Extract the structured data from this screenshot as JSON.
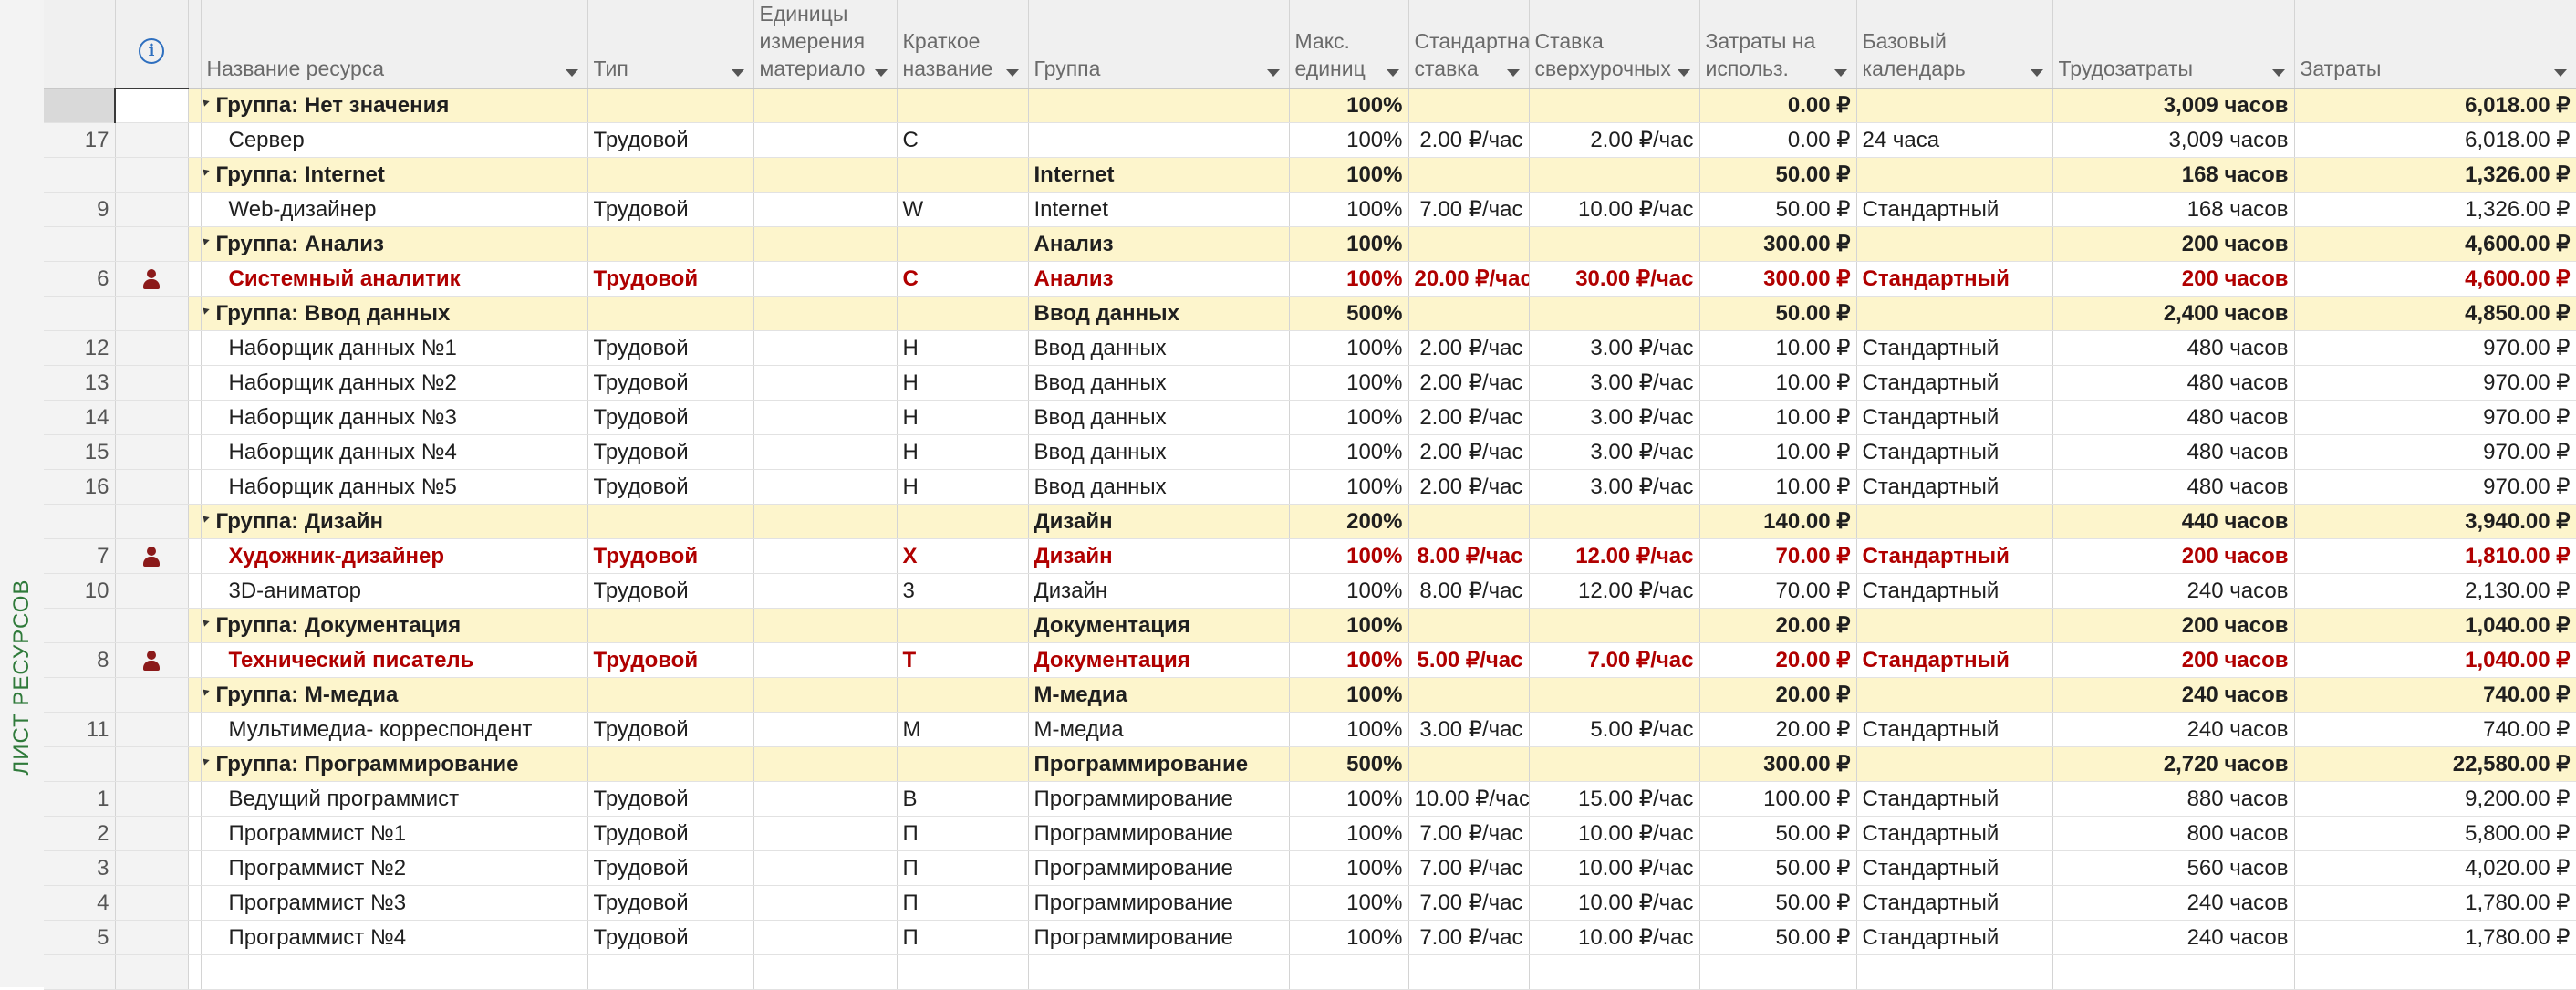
{
  "sidebar_label": "ЛИСТ РЕСУРСОВ",
  "columns": [
    {
      "key": "name",
      "label": "Название ресурса",
      "filter": true
    },
    {
      "key": "type",
      "label": "Тип",
      "filter": true
    },
    {
      "key": "units",
      "label": "Единицы\nизмерения\nматериало",
      "filter": true
    },
    {
      "key": "short",
      "label": "Краткое\nназвание",
      "filter": true
    },
    {
      "key": "group",
      "label": "Группа",
      "filter": true
    },
    {
      "key": "max",
      "label": "Макс.\nединиц",
      "filter": true
    },
    {
      "key": "std",
      "label": "Стандартная\nставка",
      "filter": true
    },
    {
      "key": "ovt",
      "label": "Ставка\nсверхурочных",
      "filter": true
    },
    {
      "key": "cpu",
      "label": "Затраты на\nиспольз.",
      "filter": true
    },
    {
      "key": "cal",
      "label": "Базовый\nкалендарь",
      "filter": true
    },
    {
      "key": "work",
      "label": "Трудозатраты",
      "filter": true
    },
    {
      "key": "cost",
      "label": "Затраты",
      "filter": true
    }
  ],
  "info_icon": "info-icon",
  "rows": [
    {
      "kind": "group",
      "name": "Группа: Нет значения",
      "group": "",
      "max": "100%",
      "cpu": "0.00 ₽",
      "work": "3,009 часов",
      "cost": "6,018.00 ₽"
    },
    {
      "kind": "res",
      "id": "17",
      "name": "Сервер",
      "type": "Трудовой",
      "short": "С",
      "group": "",
      "max": "100%",
      "std": "2.00 ₽/час",
      "ovt": "2.00 ₽/час",
      "cpu": "0.00 ₽",
      "cal": "24 часа",
      "work": "3,009 часов",
      "cost": "6,018.00 ₽"
    },
    {
      "kind": "group",
      "name": "Группа: Internet",
      "group": "Internet",
      "max": "100%",
      "cpu": "50.00 ₽",
      "work": "168 часов",
      "cost": "1,326.00 ₽"
    },
    {
      "kind": "res",
      "id": "9",
      "name": "Web-дизайнер",
      "type": "Трудовой",
      "short": "W",
      "group": "Internet",
      "max": "100%",
      "std": "7.00 ₽/час",
      "ovt": "10.00 ₽/час",
      "cpu": "50.00 ₽",
      "cal": "Стандартный",
      "work": "168 часов",
      "cost": "1,326.00 ₽"
    },
    {
      "kind": "group",
      "name": "Группа: Анализ",
      "group": "Анализ",
      "max": "100%",
      "cpu": "300.00 ₽",
      "work": "200 часов",
      "cost": "4,600.00 ₽"
    },
    {
      "kind": "res",
      "over": true,
      "id": "6",
      "name": "Системный аналитик",
      "type": "Трудовой",
      "short": "С",
      "group": "Анализ",
      "max": "100%",
      "std": "20.00 ₽/час",
      "ovt": "30.00 ₽/час",
      "cpu": "300.00 ₽",
      "cal": "Стандартный",
      "work": "200 часов",
      "cost": "4,600.00 ₽"
    },
    {
      "kind": "group",
      "name": "Группа: Ввод данных",
      "group": "Ввод данных",
      "max": "500%",
      "cpu": "50.00 ₽",
      "work": "2,400 часов",
      "cost": "4,850.00 ₽"
    },
    {
      "kind": "res",
      "id": "12",
      "name": "Наборщик данных №1",
      "type": "Трудовой",
      "short": "Н",
      "group": "Ввод данных",
      "max": "100%",
      "std": "2.00 ₽/час",
      "ovt": "3.00 ₽/час",
      "cpu": "10.00 ₽",
      "cal": "Стандартный",
      "work": "480 часов",
      "cost": "970.00 ₽"
    },
    {
      "kind": "res",
      "id": "13",
      "name": "Наборщик данных №2",
      "type": "Трудовой",
      "short": "Н",
      "group": "Ввод данных",
      "max": "100%",
      "std": "2.00 ₽/час",
      "ovt": "3.00 ₽/час",
      "cpu": "10.00 ₽",
      "cal": "Стандартный",
      "work": "480 часов",
      "cost": "970.00 ₽"
    },
    {
      "kind": "res",
      "id": "14",
      "name": "Наборщик данных №3",
      "type": "Трудовой",
      "short": "Н",
      "group": "Ввод данных",
      "max": "100%",
      "std": "2.00 ₽/час",
      "ovt": "3.00 ₽/час",
      "cpu": "10.00 ₽",
      "cal": "Стандартный",
      "work": "480 часов",
      "cost": "970.00 ₽"
    },
    {
      "kind": "res",
      "id": "15",
      "name": "Наборщик данных №4",
      "type": "Трудовой",
      "short": "Н",
      "group": "Ввод данных",
      "max": "100%",
      "std": "2.00 ₽/час",
      "ovt": "3.00 ₽/час",
      "cpu": "10.00 ₽",
      "cal": "Стандартный",
      "work": "480 часов",
      "cost": "970.00 ₽"
    },
    {
      "kind": "res",
      "id": "16",
      "name": "Наборщик данных №5",
      "type": "Трудовой",
      "short": "Н",
      "group": "Ввод данных",
      "max": "100%",
      "std": "2.00 ₽/час",
      "ovt": "3.00 ₽/час",
      "cpu": "10.00 ₽",
      "cal": "Стандартный",
      "work": "480 часов",
      "cost": "970.00 ₽"
    },
    {
      "kind": "group",
      "name": "Группа: Дизайн",
      "group": "Дизайн",
      "max": "200%",
      "cpu": "140.00 ₽",
      "work": "440 часов",
      "cost": "3,940.00 ₽"
    },
    {
      "kind": "res",
      "over": true,
      "id": "7",
      "name": "Художник-дизайнер",
      "type": "Трудовой",
      "short": "Х",
      "group": "Дизайн",
      "max": "100%",
      "std": "8.00 ₽/час",
      "ovt": "12.00 ₽/час",
      "cpu": "70.00 ₽",
      "cal": "Стандартный",
      "work": "200 часов",
      "cost": "1,810.00 ₽"
    },
    {
      "kind": "res",
      "id": "10",
      "name": "3D-аниматор",
      "type": "Трудовой",
      "short": "3",
      "group": "Дизайн",
      "max": "100%",
      "std": "8.00 ₽/час",
      "ovt": "12.00 ₽/час",
      "cpu": "70.00 ₽",
      "cal": "Стандартный",
      "work": "240 часов",
      "cost": "2,130.00 ₽"
    },
    {
      "kind": "group",
      "name": "Группа: Документация",
      "group": "Документация",
      "max": "100%",
      "cpu": "20.00 ₽",
      "work": "200 часов",
      "cost": "1,040.00 ₽"
    },
    {
      "kind": "res",
      "over": true,
      "id": "8",
      "name": "Технический писатель",
      "type": "Трудовой",
      "short": "Т",
      "group": "Документация",
      "max": "100%",
      "std": "5.00 ₽/час",
      "ovt": "7.00 ₽/час",
      "cpu": "20.00 ₽",
      "cal": "Стандартный",
      "work": "200 часов",
      "cost": "1,040.00 ₽"
    },
    {
      "kind": "group",
      "name": "Группа: М-медиа",
      "group": "М-медиа",
      "max": "100%",
      "cpu": "20.00 ₽",
      "work": "240 часов",
      "cost": "740.00 ₽"
    },
    {
      "kind": "res",
      "id": "11",
      "name": "Мультимедиа- корреспондент",
      "type": "Трудовой",
      "short": "М",
      "group": "М-медиа",
      "max": "100%",
      "std": "3.00 ₽/час",
      "ovt": "5.00 ₽/час",
      "cpu": "20.00 ₽",
      "cal": "Стандартный",
      "work": "240 часов",
      "cost": "740.00 ₽"
    },
    {
      "kind": "group",
      "name": "Группа: Программирование",
      "group": "Программирование",
      "max": "500%",
      "cpu": "300.00 ₽",
      "work": "2,720 часов",
      "cost": "22,580.00 ₽"
    },
    {
      "kind": "res",
      "id": "1",
      "name": "Ведущий программист",
      "type": "Трудовой",
      "short": "В",
      "group": "Программирование",
      "max": "100%",
      "std": "10.00 ₽/час",
      "ovt": "15.00 ₽/час",
      "cpu": "100.00 ₽",
      "cal": "Стандартный",
      "work": "880 часов",
      "cost": "9,200.00 ₽"
    },
    {
      "kind": "res",
      "id": "2",
      "name": "Программист №1",
      "type": "Трудовой",
      "short": "П",
      "group": "Программирование",
      "max": "100%",
      "std": "7.00 ₽/час",
      "ovt": "10.00 ₽/час",
      "cpu": "50.00 ₽",
      "cal": "Стандартный",
      "work": "800 часов",
      "cost": "5,800.00 ₽"
    },
    {
      "kind": "res",
      "id": "3",
      "name": "Программист №2",
      "type": "Трудовой",
      "short": "П",
      "group": "Программирование",
      "max": "100%",
      "std": "7.00 ₽/час",
      "ovt": "10.00 ₽/час",
      "cpu": "50.00 ₽",
      "cal": "Стандартный",
      "work": "560 часов",
      "cost": "4,020.00 ₽"
    },
    {
      "kind": "res",
      "id": "4",
      "name": "Программист №3",
      "type": "Трудовой",
      "short": "П",
      "group": "Программирование",
      "max": "100%",
      "std": "7.00 ₽/час",
      "ovt": "10.00 ₽/час",
      "cpu": "50.00 ₽",
      "cal": "Стандартный",
      "work": "240 часов",
      "cost": "1,780.00 ₽"
    },
    {
      "kind": "res",
      "id": "5",
      "name": "Программист №4",
      "type": "Трудовой",
      "short": "П",
      "group": "Программирование",
      "max": "100%",
      "std": "7.00 ₽/час",
      "ovt": "10.00 ₽/час",
      "cpu": "50.00 ₽",
      "cal": "Стандартный",
      "work": "240 часов",
      "cost": "1,780.00 ₽"
    }
  ]
}
